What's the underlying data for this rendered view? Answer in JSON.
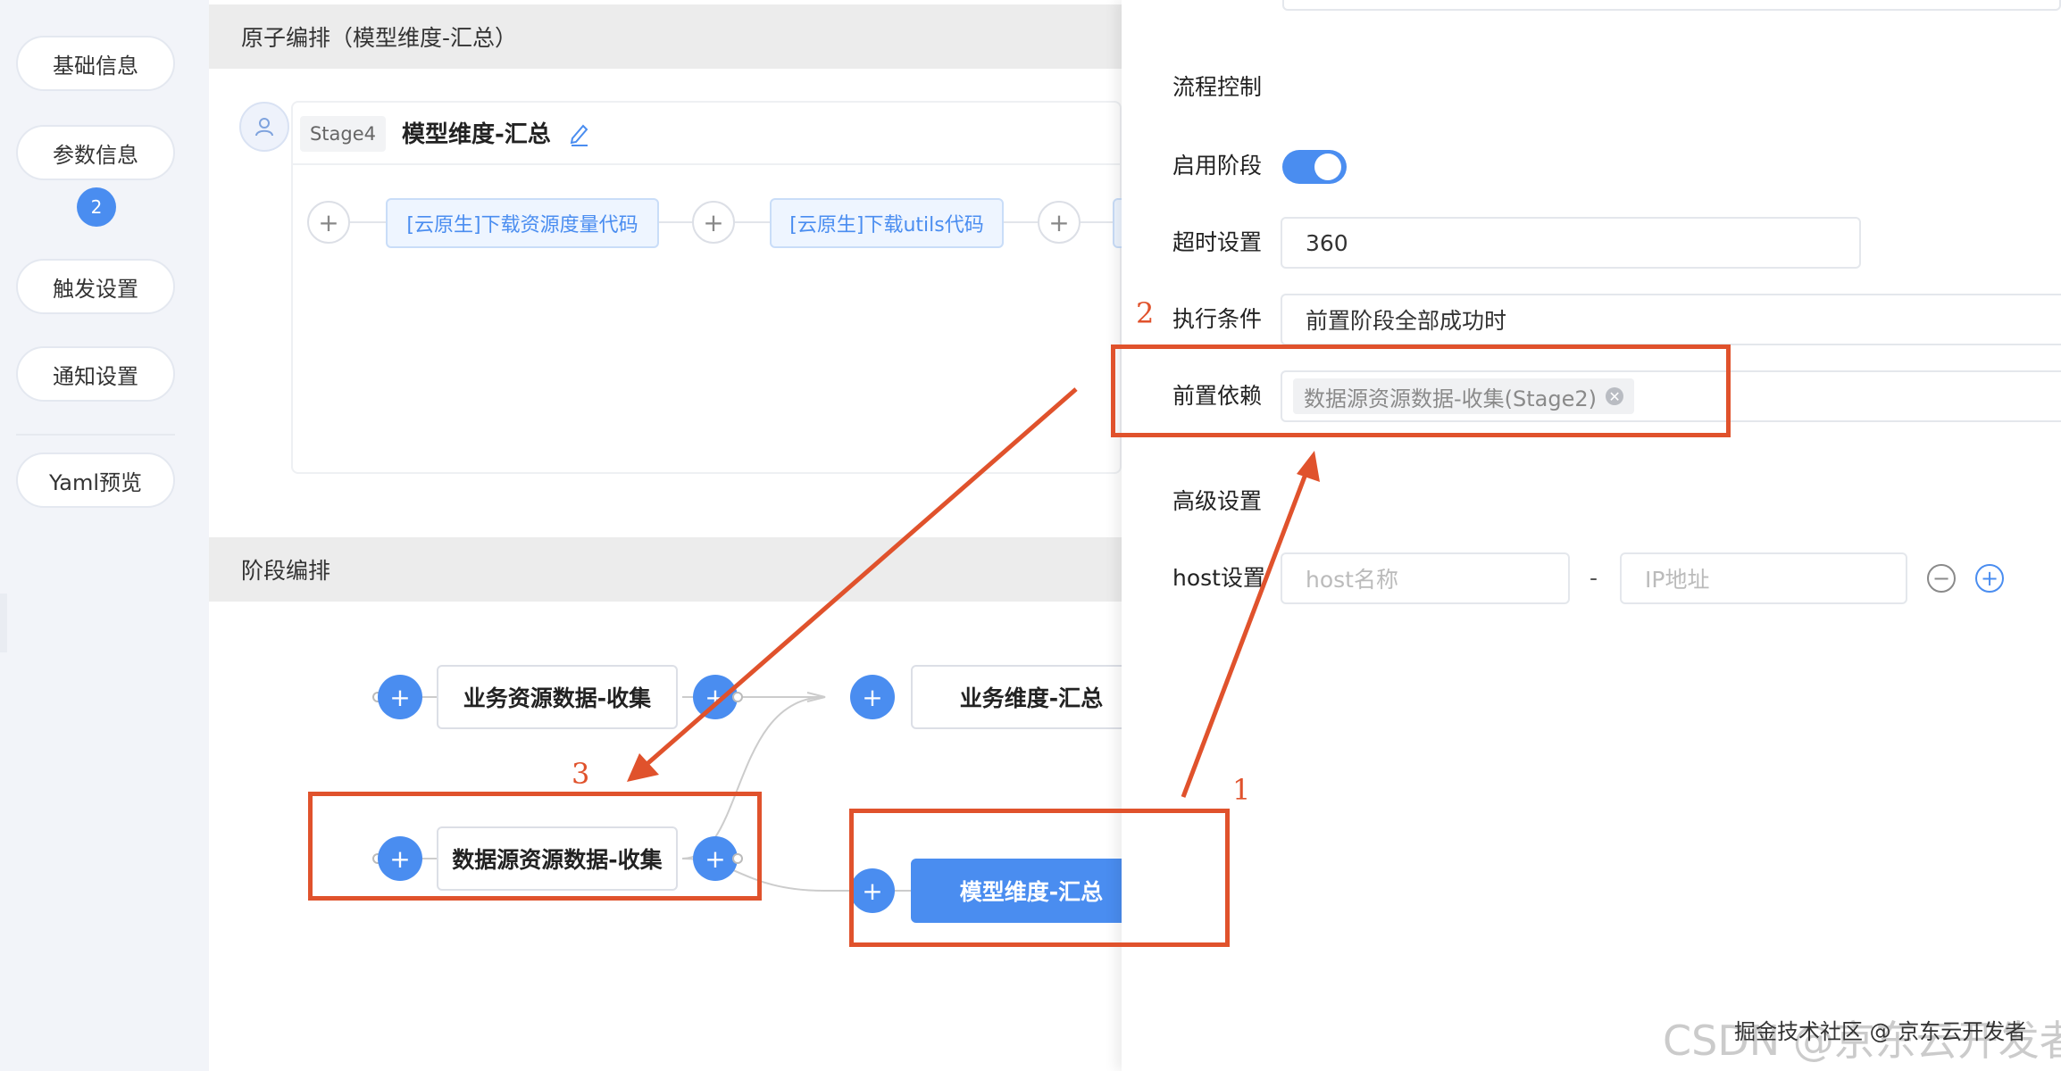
{
  "sidebar": {
    "items": [
      {
        "label": "基础信息"
      },
      {
        "label": "参数信息",
        "badge": "2"
      },
      {
        "label": "触发设置"
      },
      {
        "label": "通知设置"
      },
      {
        "label": "Yaml预览"
      }
    ]
  },
  "atom_section": {
    "title": "原子编排（模型维度-汇总）",
    "stage_tag": "Stage4",
    "stage_name": "模型维度-汇总",
    "atoms": [
      {
        "label": "[云原生]下载资源度量代码"
      },
      {
        "label": "[云原生]下载utils代码"
      }
    ],
    "add_symbol": "+"
  },
  "stage_section": {
    "title": "阶段编排",
    "stages": [
      {
        "label": "业务资源数据-收集"
      },
      {
        "label": "业务维度-汇总"
      },
      {
        "label": "数据源资源数据-收集"
      },
      {
        "label": "模型维度-汇总",
        "active": true
      }
    ],
    "add_symbol": "+"
  },
  "right_panel": {
    "flow_control_title": "流程控制",
    "enable_stage_label": "启用阶段",
    "enable_stage_value": true,
    "timeout_label": "超时设置",
    "timeout_value": "360",
    "condition_label": "执行条件",
    "condition_value": "前置阶段全部成功时",
    "dependency_label": "前置依赖",
    "dependency_tag": "数据源资源数据-收集(Stage2)",
    "advanced_title": "高级设置",
    "host_label": "host设置",
    "host_name_placeholder": "host名称",
    "host_separator": "-",
    "host_ip_placeholder": "IP地址",
    "remove_symbol": "−",
    "add_symbol": "+"
  },
  "annotations": {
    "marker_1": "1",
    "marker_2": "2",
    "marker_3": "3",
    "color": "#e0522c"
  },
  "watermark": {
    "line1": "掘金技术社区 @ 京东云开发者",
    "line2": "CSDN @京东云开发者"
  },
  "colors": {
    "accent": "#4a8df0",
    "annotation": "#e0522c"
  }
}
